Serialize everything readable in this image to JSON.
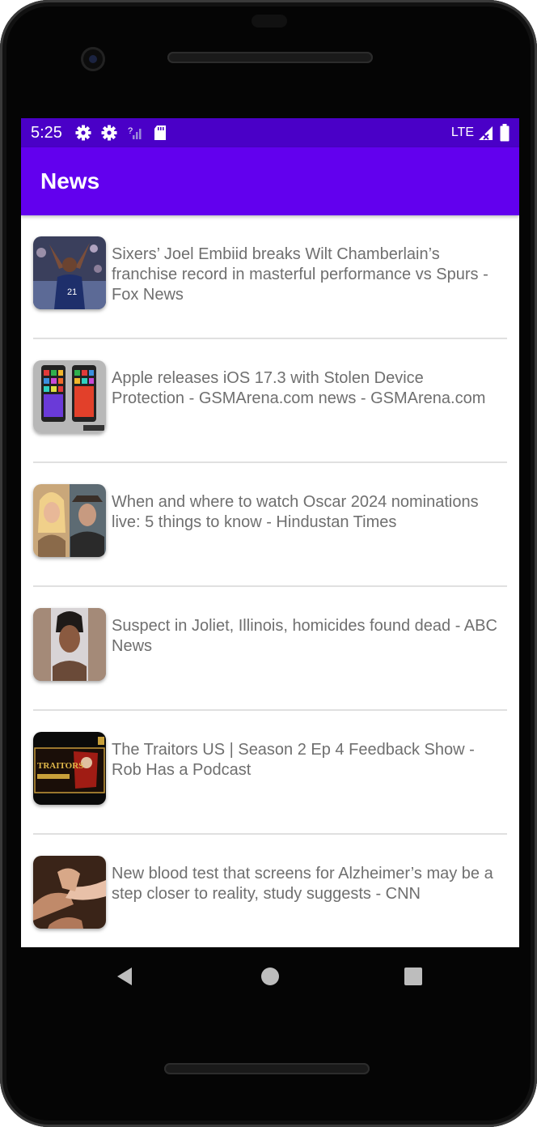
{
  "status_bar": {
    "time": "5:25",
    "network": "LTE",
    "icons": [
      "gear-icon",
      "gear-icon",
      "signal-question-icon",
      "sd-card-icon",
      "lte-signal-icon",
      "battery-icon"
    ]
  },
  "app_bar": {
    "title": "News"
  },
  "news_items": [
    {
      "headline": "Sixers’ Joel Embiid breaks Wilt Chamberlain’s franchise record in masterful performance vs Spurs - Fox News",
      "thumbnail": "basketball-player-image"
    },
    {
      "headline": "Apple releases iOS 17.3 with Stolen Device Protection - GSMArena.com news - GSMArena.com",
      "thumbnail": "smartphones-image"
    },
    {
      "headline": "When and where to watch Oscar 2024 nominations live: 5 things to know - Hindustan Times",
      "thumbnail": "movie-stars-image"
    },
    {
      "headline": "Suspect in Joliet, Illinois, homicides found dead - ABC News",
      "thumbnail": "portrait-image"
    },
    {
      "headline": "The Traitors US | Season 2 Ep 4 Feedback Show - Rob Has a Podcast",
      "thumbnail": "podcast-cover-image"
    },
    {
      "headline": "New blood test that screens for Alzheimer’s may be a step closer to reality, study suggests - CNN",
      "thumbnail": "holding-hands-image"
    }
  ],
  "thumb_text": {
    "podcast_title": "TRAITORS"
  },
  "nav_bar": {
    "buttons": [
      "back-icon",
      "home-icon",
      "recents-icon"
    ]
  },
  "colors": {
    "status_bar": "#4a00c7",
    "app_bar": "#6200ee",
    "headline_text": "#6f6f6f"
  }
}
